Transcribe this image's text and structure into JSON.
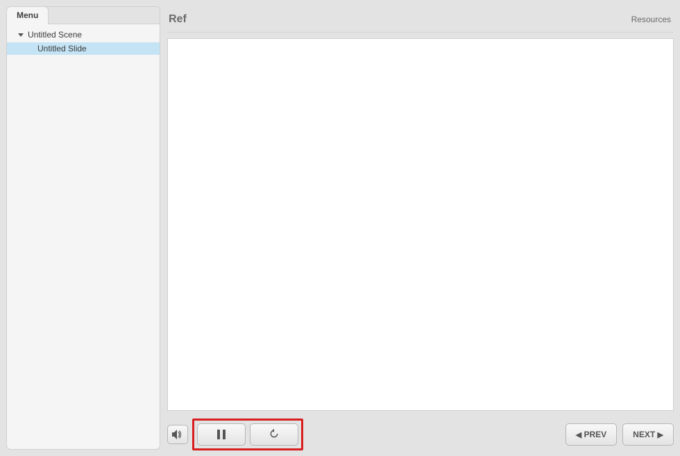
{
  "sidebar": {
    "tab_label": "Menu",
    "scene_label": "Untitled Scene",
    "slide_label": "Untitled Slide"
  },
  "header": {
    "title": "Ref",
    "resources_label": "Resources"
  },
  "playbar": {
    "prev_label": "PREV",
    "next_label": "NEXT"
  }
}
